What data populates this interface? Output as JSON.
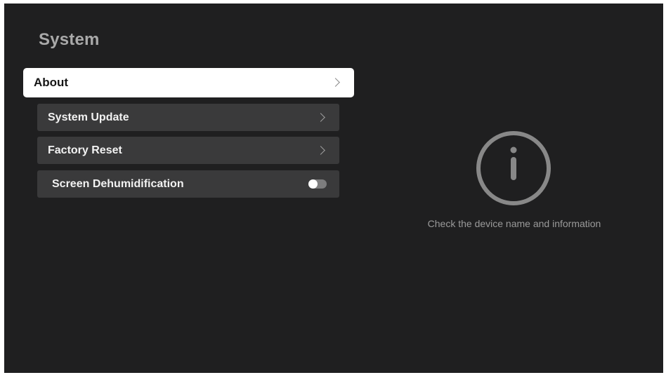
{
  "page": {
    "title": "System"
  },
  "menu": {
    "items": [
      {
        "label": "About",
        "trailing": "chevron-right-icon",
        "state": "focused"
      },
      {
        "label": "System Update",
        "trailing": "chevron-right-icon"
      },
      {
        "label": "Factory Reset",
        "trailing": "chevron-right-icon"
      },
      {
        "label": "Screen Dehumidification",
        "trailing": "toggle",
        "toggle_on": false
      }
    ]
  },
  "detail": {
    "icon": "info-icon",
    "text": "Check the device name and information"
  },
  "colors": {
    "background": "#1f1f20",
    "focused_item": "#ffffff",
    "item": "#3a3a3b",
    "title": "#a9a9a9"
  }
}
